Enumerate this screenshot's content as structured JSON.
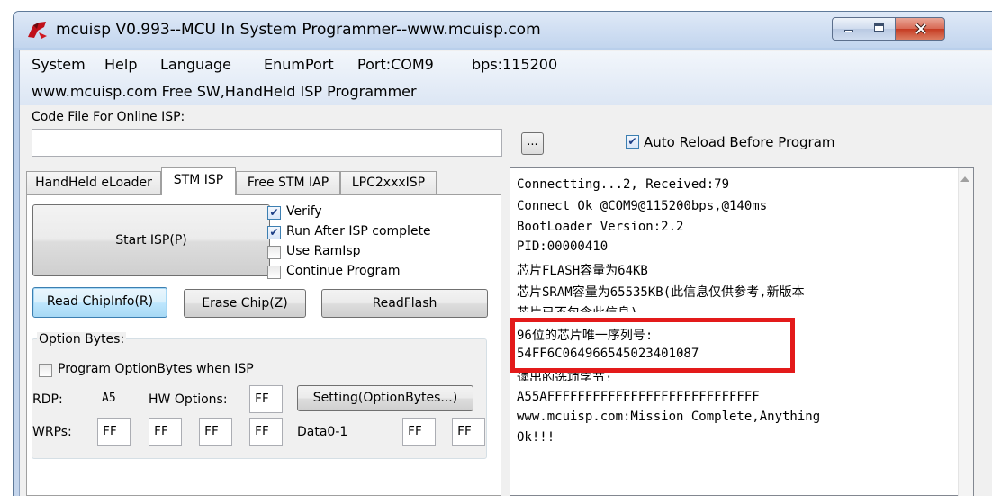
{
  "window": {
    "title": "mcuisp V0.993--MCU In System Programmer--www.mcuisp.com"
  },
  "menu": {
    "items": [
      "System",
      "Help",
      "Language",
      "EnumPort",
      "Port:COM9",
      "bps:115200"
    ],
    "website_line": "www.mcuisp.com Free SW,HandHeld ISP Programmer"
  },
  "code_file": {
    "label": "Code File For Online ISP:",
    "value": "",
    "browse_label": "...",
    "auto_reload_label": "Auto Reload Before Program",
    "auto_reload_checked": true
  },
  "tabs": [
    "HandHeld eLoader",
    "STM ISP",
    "Free STM IAP",
    "LPC2xxxISP"
  ],
  "active_tab": "STM ISP",
  "stm_isp": {
    "start_label": "Start ISP(P)",
    "options": [
      {
        "label": "Verify",
        "checked": true
      },
      {
        "label": "Run After ISP complete",
        "checked": true
      },
      {
        "label": "Use RamIsp",
        "checked": false
      },
      {
        "label": "Continue Program",
        "checked": false
      }
    ],
    "read_chip_label": "Read ChipInfo(R)",
    "erase_chip_label": "Erase Chip(Z)",
    "read_flash_label": "ReadFlash"
  },
  "option_bytes": {
    "group_label": "Option Bytes:",
    "program_label": "Program OptionBytes when ISP",
    "program_checked": false,
    "rdp_label": "RDP:",
    "rdp_value": "A5",
    "hw_label": "HW Options:",
    "hw_value": "FF",
    "setting_label": "Setting(OptionBytes...)",
    "wrps_label": "WRPs:",
    "wrps_values": [
      "FF",
      "FF",
      "FF",
      "FF"
    ],
    "data_label": "Data0-1",
    "data_values": [
      "FF",
      "FF"
    ]
  },
  "log": {
    "lines": [
      "Connectting...2, Received:79",
      "Connect Ok @COM9@115200bps,@140ms",
      "BootLoader Version:2.2",
      "PID:00000410",
      "芯片FLASH容量为64KB",
      "芯片SRAM容量为65535KB(此信息仅供参考,新版本",
      "芯片已不包含此信息)",
      "96位的芯片唯一序列号:",
      "54FF6C064966545023401087",
      "读出的选项字节:",
      "A55AFFFFFFFFFFFFFFFFFFFFFFFFFFFF",
      " www.mcuisp.com:Mission Complete,Anything",
      "Ok!!!"
    ]
  },
  "colors": {
    "highlight": "#e31a1a",
    "title_gradient_top": "#dfe9f7",
    "close_button": "#c53b22"
  }
}
